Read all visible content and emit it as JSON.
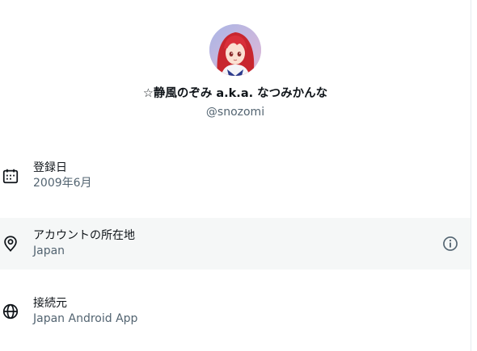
{
  "profile": {
    "display_name": "☆静風のぞみ a.k.a. なつみかんな",
    "handle": "@snozomi",
    "avatar_alt": "avatar"
  },
  "details": [
    {
      "label": "登録日",
      "value": "2009年6月",
      "icon": "calendar-icon"
    },
    {
      "label": "アカウントの所在地",
      "value": "Japan",
      "icon": "location-pin-icon",
      "action_icon": "info-icon"
    },
    {
      "label": "接続元",
      "value": "Japan Android App",
      "icon": "globe-icon"
    }
  ],
  "colors": {
    "primary_text": "#0f1419",
    "secondary_text": "#536471",
    "highlight_row": "#f5f7f7"
  }
}
